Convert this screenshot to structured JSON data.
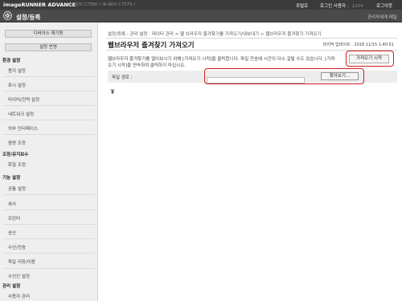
{
  "topbar": {
    "brand": "imageRUNNER ADVANCE",
    "model": "iR-ADV C7580 / iR-ADV C7570 /",
    "portal": "포털로",
    "login_label": "로그인 사용자 :",
    "login_user": "1234",
    "logout": "로그아웃"
  },
  "header": {
    "title": "설정/등록",
    "mail_admin": "관리자에게 메일"
  },
  "sidebar": {
    "device_restart": "디바이스 재기동",
    "apply_settings": "설정 반영",
    "sections": [
      {
        "label": "환경 설정",
        "items": [
          "용지 설정",
          "표시 설정",
          "타이머/전력 설정",
          "네트워크 설정",
          "외부 인터페이스",
          "음량 조정"
        ]
      },
      {
        "label": "조정/유지보수",
        "items": [
          "화질 조정"
        ]
      },
      {
        "label": "기능 설정",
        "items": [
          "공통 설정",
          "복사",
          "프린터",
          "송신",
          "수신/전송",
          "파일 저장/이용"
        ]
      },
      {
        "label": "",
        "items": [
          "수신인 설정"
        ]
      },
      {
        "label": "관리 설정",
        "items": [
          "사용자 관리"
        ]
      }
    ]
  },
  "main": {
    "breadcrumb": "설정/등록 : 관리 설정 : 데이터 관리 > 웹 브라우저 즐겨찾기를 가져오기/내보내기 > 웹브라우저 즐겨찾기 가져오기",
    "page_title": "웹브라우저 즐겨찾기 가져오기",
    "last_updated": "마지막 업데이트 : 2018 11/15 1:40:51",
    "description": "웹브라우저 즐겨찾기를 열어보시기 위해 [가져오기 시작]을 클릭합니다. 파일 전송에 시간이 다소 걸릴 수도 있습니다. [가져오기 시작]을 연속하여 클릭하지 마십시오.",
    "start_import_button": "가져오기 시작",
    "file_path_label": "파일 경로 :",
    "file_path_value": "",
    "browse_button": "찾아보기..."
  },
  "icons": {
    "header": "settings-gear-icon",
    "page_top": "page-top-arrow-icon"
  },
  "colors": {
    "topbar_bg": "#3a3a3a",
    "header_bg": "#4a4a4a",
    "highlight": "#d01f1f"
  }
}
